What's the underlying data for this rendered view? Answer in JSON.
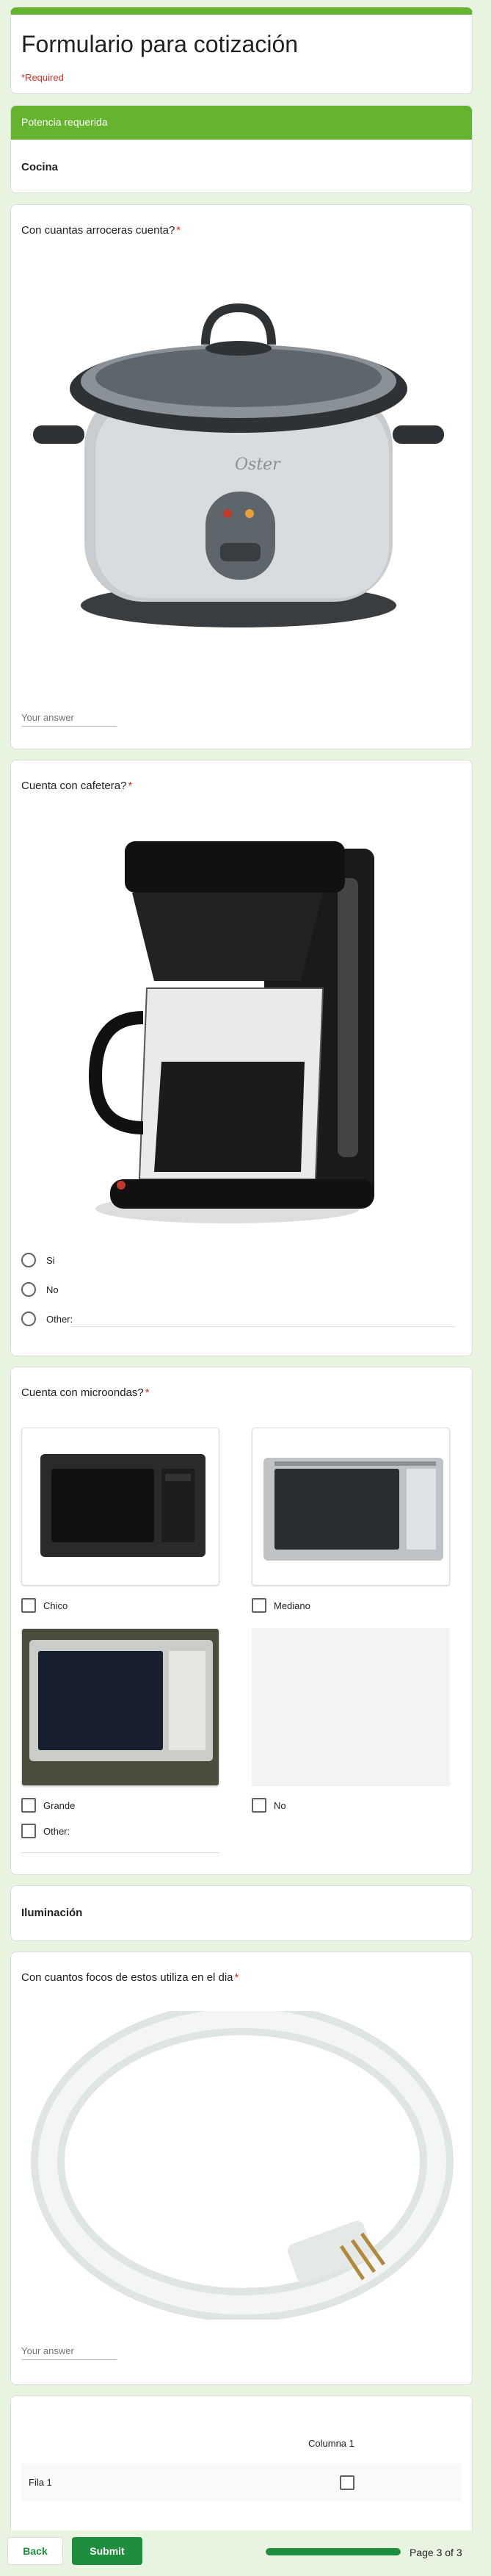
{
  "header": {
    "title": "Formulario para cotización",
    "required_note": "*Required",
    "accent_color": "#65b32e"
  },
  "section": {
    "title": "Potencia requerida"
  },
  "cocina": {
    "title": "Cocina"
  },
  "q_arroceras": {
    "label": "Con cuantas arroceras cuenta?",
    "required_mark": "*",
    "placeholder": "Your answer",
    "image": "rice-cooker-image",
    "brand": "Oster"
  },
  "q_cafetera": {
    "label": "Cuenta con cafetera?",
    "required_mark": "*",
    "image": "coffee-maker-image",
    "options": [
      "Si",
      "No",
      "Other:"
    ]
  },
  "q_microondas": {
    "label": "Cuenta con microondas?",
    "required_mark": "*",
    "options": [
      "Chico",
      "Mediano",
      "Grande",
      "No",
      "Other:"
    ]
  },
  "iluminacion": {
    "title": "Iluminación"
  },
  "q_focos": {
    "label": "Con cuantos focos de estos utiliza en el dia",
    "required_mark": "*",
    "placeholder": "Your answer",
    "image": "circular-fluorescent-bulb-image"
  },
  "grid": {
    "column": "Columna 1",
    "row": "Fila 1"
  },
  "footer": {
    "back_label": "Back",
    "submit_label": "Submit",
    "page_label": "Page 3 of 3",
    "progress": 1.0,
    "submit_color": "#1e8e3e"
  }
}
